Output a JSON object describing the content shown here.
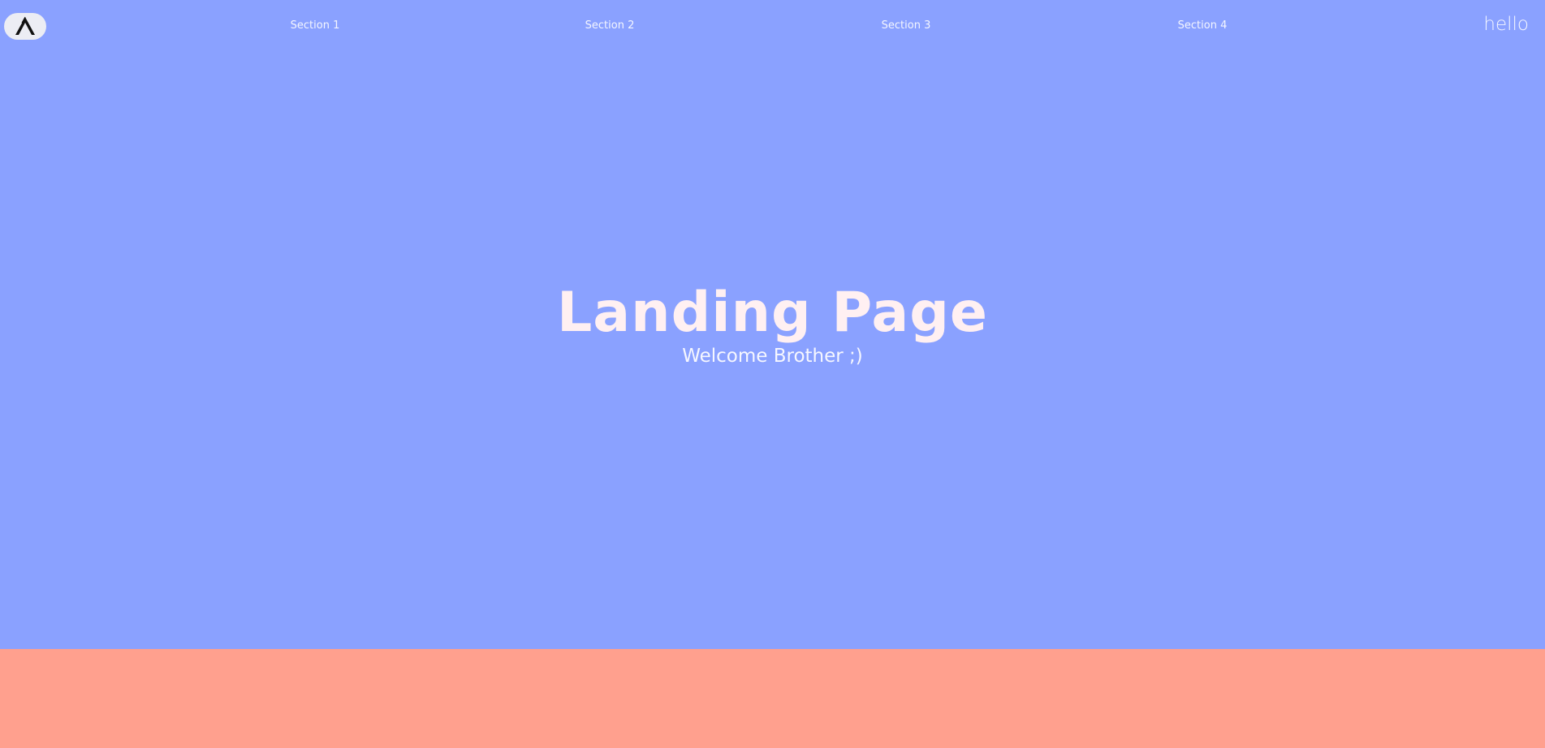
{
  "navbar": {
    "logo_icon": "mountain-peak-icon",
    "links": [
      {
        "label": "Section 1"
      },
      {
        "label": "Section 2"
      },
      {
        "label": "Section 3"
      },
      {
        "label": "Section 4"
      }
    ],
    "greeting": "hello"
  },
  "hero": {
    "title": "Landing Page",
    "subtitle": "Welcome Brother ;)"
  },
  "colors": {
    "hero_background": "#8aa1ff",
    "next_section_background": "#ffa08e",
    "logo_pill_background": "#ecedf4",
    "text": "#fff0f2"
  }
}
